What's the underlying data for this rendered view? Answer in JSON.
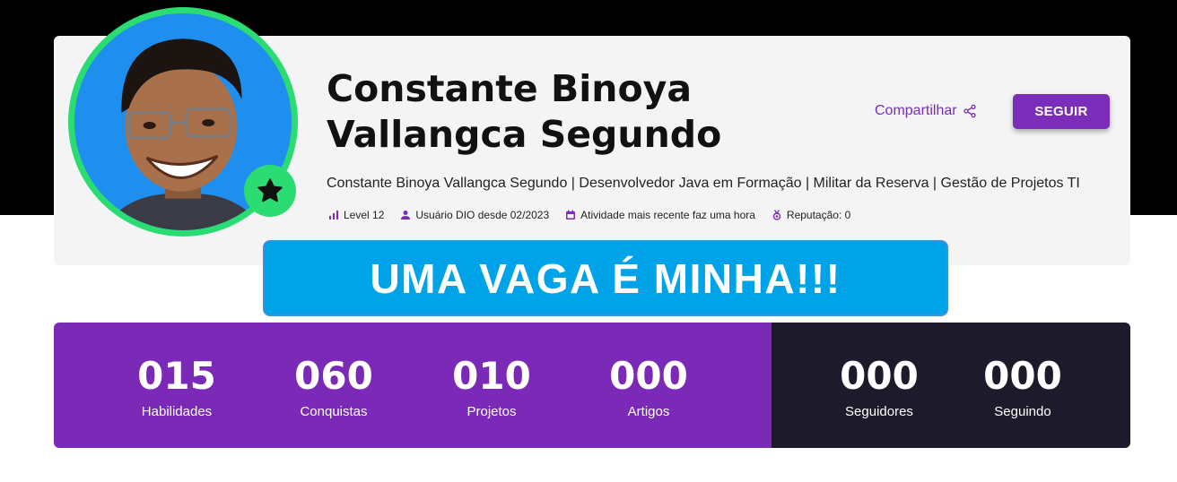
{
  "profile": {
    "name": "Constante Binoya Vallangca Segundo",
    "headline": "Constante Binoya Vallangca Segundo | Desenvolvedor Java em Formação | Militar da Reserva | Gestão de Projetos TI",
    "share_label": "Compartilhar",
    "follow_label": "SEGUIR",
    "avatar_icon": "user-photo",
    "badge_icon": "star-icon",
    "meta": {
      "level": "Level 12",
      "member_since": "Usuário DIO desde 02/2023",
      "activity": "Atividade mais recente faz uma hora",
      "reputation": "Reputação: 0"
    }
  },
  "banner": {
    "text": "UMA VAGA É MINHA!!!"
  },
  "stats": {
    "skills": {
      "value": "015",
      "label": "Habilidades"
    },
    "achievements": {
      "value": "060",
      "label": "Conquistas"
    },
    "projects": {
      "value": "010",
      "label": "Projetos"
    },
    "articles": {
      "value": "000",
      "label": "Artigos"
    },
    "followers": {
      "value": "000",
      "label": "Seguidores"
    },
    "following": {
      "value": "000",
      "label": "Seguindo"
    }
  },
  "colors": {
    "accent": "#7b2cb8",
    "ring": "#2bdc73",
    "banner": "#00a2e8",
    "dark_panel": "#1d1a2c"
  }
}
